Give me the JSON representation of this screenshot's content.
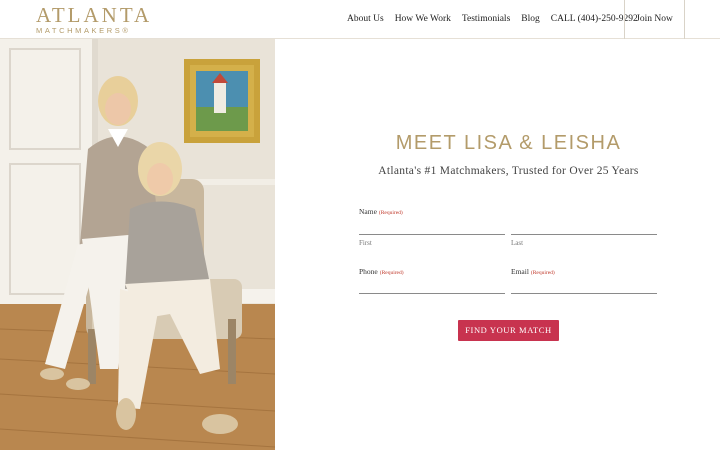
{
  "logo": {
    "main": "ATLANTA",
    "sub": "MATCHMAKERS®"
  },
  "nav": {
    "items": [
      "About Us",
      "How We Work",
      "Testimonials",
      "Blog",
      "CALL (404)-250-9292"
    ],
    "join": "Join Now"
  },
  "hero": {
    "title": "MEET LISA & LEISHA",
    "subtitle": "Atlanta's #1 Matchmakers, Trusted for Over 25 Years"
  },
  "form": {
    "name_label": "Name",
    "required": "(Required)",
    "first": "First",
    "last": "Last",
    "phone_label": "Phone",
    "email_label": "Email",
    "submit": "FIND YOUR MATCH"
  },
  "colors": {
    "brand_gold": "#b39b6a",
    "button": "#c8334f"
  }
}
